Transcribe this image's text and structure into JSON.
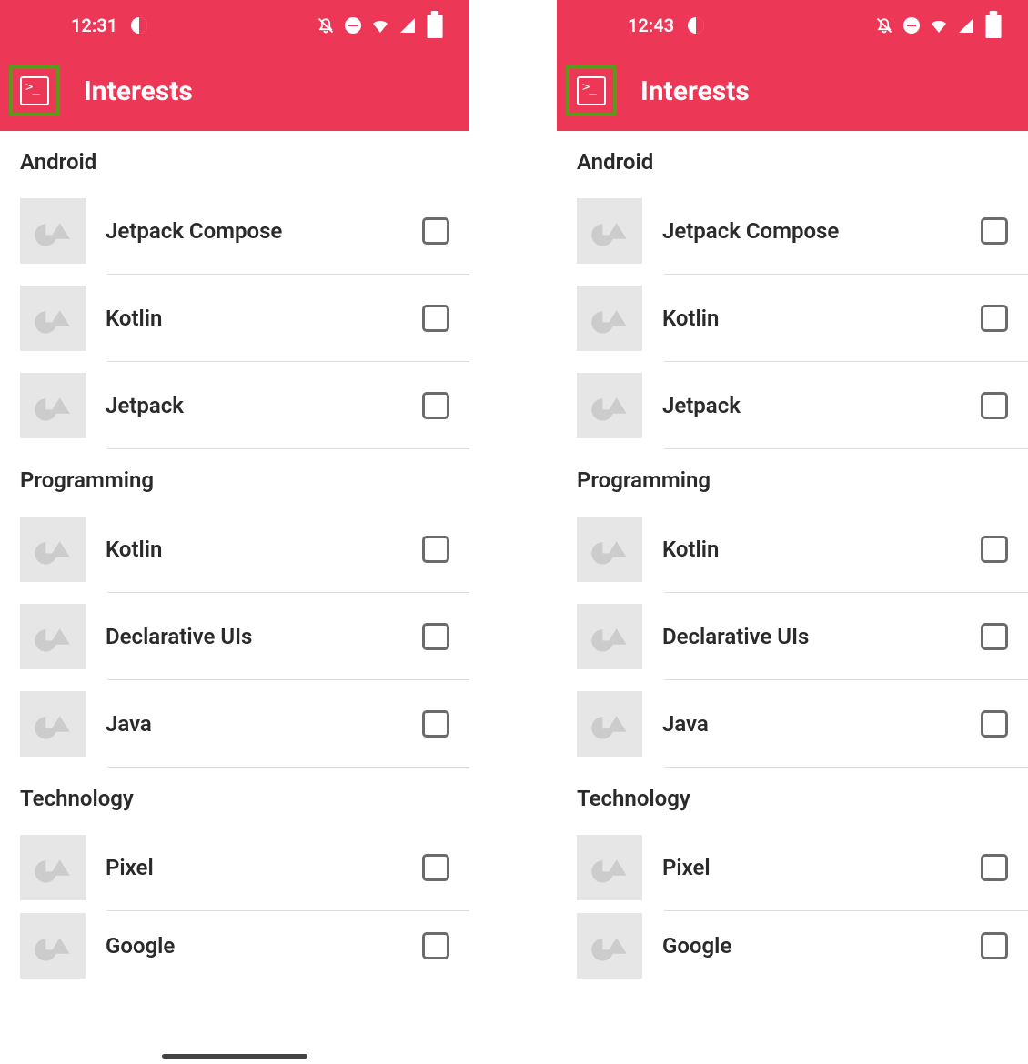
{
  "phones": [
    {
      "time": "12:31",
      "title": "Interests",
      "sections": [
        {
          "header": "Android",
          "items": [
            "Jetpack Compose",
            "Kotlin",
            "Jetpack"
          ]
        },
        {
          "header": "Programming",
          "items": [
            "Kotlin",
            "Declarative UIs",
            "Java"
          ]
        },
        {
          "header": "Technology",
          "items": [
            "Pixel",
            "Google"
          ]
        }
      ]
    },
    {
      "time": "12:43",
      "title": "Interests",
      "sections": [
        {
          "header": "Android",
          "items": [
            "Jetpack Compose",
            "Kotlin",
            "Jetpack"
          ]
        },
        {
          "header": "Programming",
          "items": [
            "Kotlin",
            "Declarative UIs",
            "Java"
          ]
        },
        {
          "header": "Technology",
          "items": [
            "Pixel",
            "Google"
          ]
        }
      ]
    }
  ]
}
